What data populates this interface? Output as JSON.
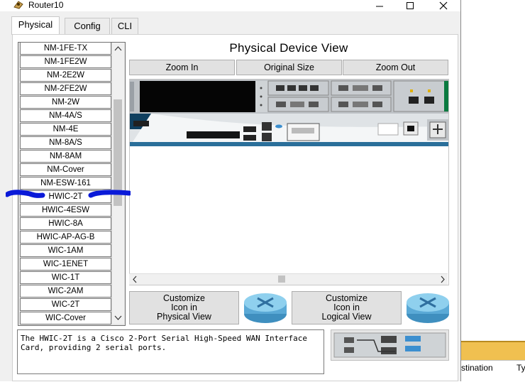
{
  "window": {
    "title": "Router10"
  },
  "tabs": [
    "Physical",
    "Config",
    "CLI"
  ],
  "modules": [
    "NM-1FE-TX",
    "NM-1FE2W",
    "NM-2E2W",
    "NM-2FE2W",
    "NM-2W",
    "NM-4A/S",
    "NM-4E",
    "NM-8A/S",
    "NM-8AM",
    "NM-Cover",
    "NM-ESW-161",
    "HWIC-2T",
    "HWIC-4ESW",
    "HWIC-8A",
    "HWIC-AP-AG-B",
    "WIC-1AM",
    "WIC-1ENET",
    "WIC-1T",
    "WIC-2AM",
    "WIC-2T",
    "WIC-Cover"
  ],
  "selected_module": "HWIC-2T",
  "physical_view": {
    "title": "Physical Device View",
    "zoom_in": "Zoom In",
    "original_size": "Original Size",
    "zoom_out": "Zoom Out"
  },
  "customize": {
    "physical": [
      "Customize",
      "Icon in",
      "Physical View"
    ],
    "logical": [
      "Customize",
      "Icon in",
      "Logical View"
    ]
  },
  "description": "The HWIC-2T is a Cisco 2-Port Serial High-Speed WAN Interface Card, providing 2 serial ports.",
  "background_window": {
    "col1": "stination",
    "col2": "Ty"
  },
  "colors": {
    "accent_blue": "#3c8fcf",
    "router_blue": "#5aa9d6",
    "annotation": "#0a1ad8"
  }
}
